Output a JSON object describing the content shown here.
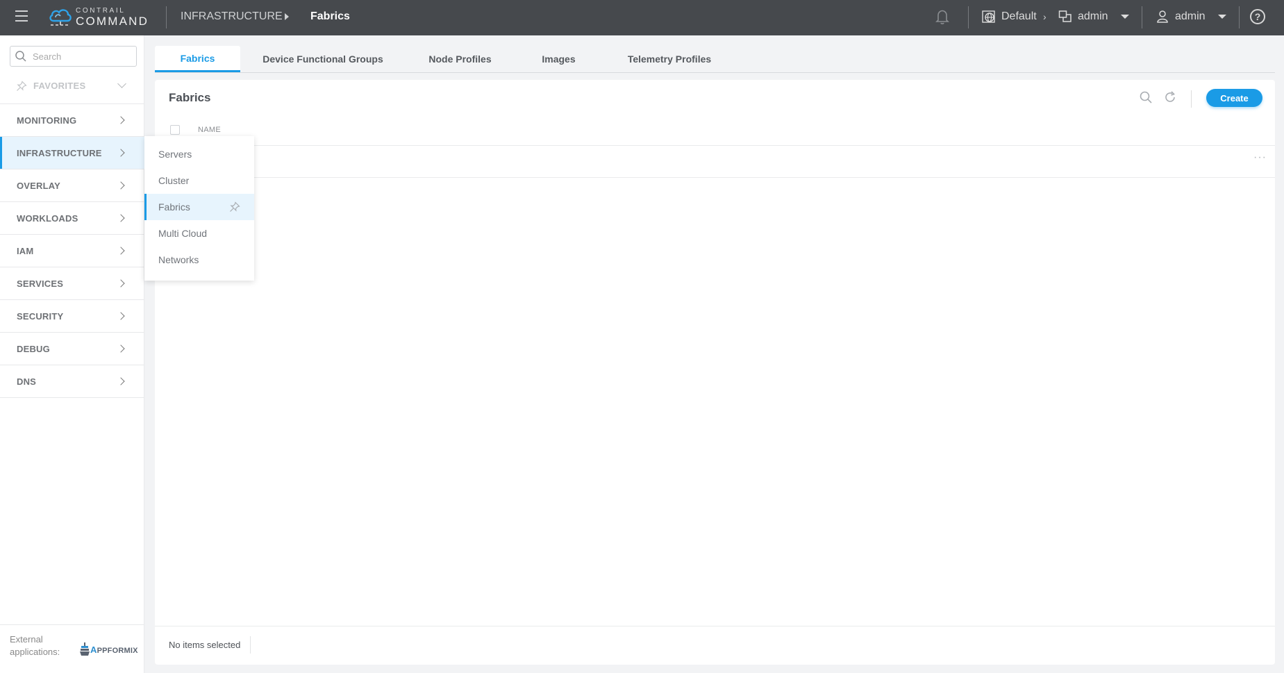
{
  "header": {
    "app_name_small": "CONTRAIL",
    "app_name_big": "COMMAND",
    "breadcrumb": [
      "INFRASTRUCTURE",
      "Fabrics"
    ],
    "domain": "Default",
    "project": "admin",
    "user": "admin",
    "help_glyph": "?"
  },
  "sidebar": {
    "search_placeholder": "Search",
    "favorites_label": "FAVORITES",
    "items": [
      {
        "label": "MONITORING"
      },
      {
        "label": "INFRASTRUCTURE",
        "active": true
      },
      {
        "label": "OVERLAY"
      },
      {
        "label": "WORKLOADS"
      },
      {
        "label": "IAM"
      },
      {
        "label": "SERVICES"
      },
      {
        "label": "SECURITY"
      },
      {
        "label": "DEBUG"
      },
      {
        "label": "DNS"
      }
    ],
    "external_label": "External applications:",
    "external_app": {
      "first": "A",
      "rest": "PPFORMIX"
    }
  },
  "flyout": {
    "items": [
      {
        "label": "Servers"
      },
      {
        "label": "Cluster"
      },
      {
        "label": "Fabrics",
        "active": true
      },
      {
        "label": "Multi Cloud"
      },
      {
        "label": "Networks"
      }
    ]
  },
  "tabs": [
    {
      "label": "Fabrics",
      "active": true
    },
    {
      "label": "Device Functional Groups"
    },
    {
      "label": "Node Profiles"
    },
    {
      "label": "Images"
    },
    {
      "label": "Telemetry Profiles"
    }
  ],
  "card": {
    "title": "Fabrics",
    "create_label": "Create",
    "column_name": "NAME",
    "row_more": "···",
    "footer_status": "No items selected"
  },
  "colors": {
    "accent": "#1a9be6",
    "header_bg": "#46494d",
    "active_bg": "#e7f4fd"
  }
}
